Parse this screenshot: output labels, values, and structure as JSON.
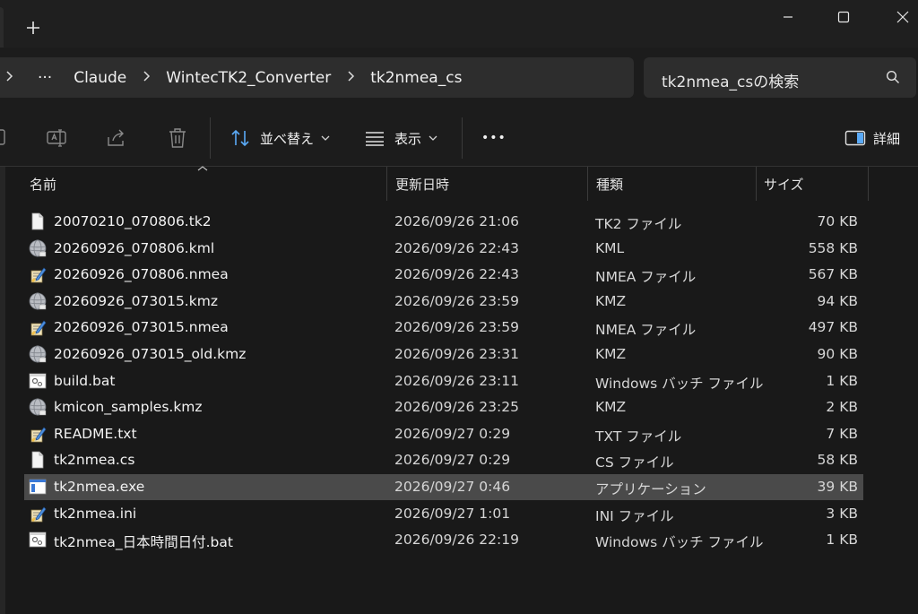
{
  "address": {
    "crumbs": [
      "Claude",
      "WintecTK2_Converter",
      "tk2nmea_cs"
    ],
    "more": "···",
    "search_placeholder": "tk2nmea_csの検索"
  },
  "toolbar": {
    "sort_label": "並べ替え",
    "view_label": "表示",
    "more_label": "•••",
    "details_label": "詳細"
  },
  "columns": {
    "name": "名前",
    "date": "更新日時",
    "type": "種類",
    "size": "サイズ"
  },
  "files": [
    {
      "name": "20070210_070806.tk2",
      "date": "2026/09/26 21:06",
      "type": "TK2 ファイル",
      "size": "70 KB",
      "icon": "file-blank-icon"
    },
    {
      "name": "20260926_070806.kml",
      "date": "2026/09/26 22:43",
      "type": "KML",
      "size": "558 KB",
      "icon": "globe-file-icon"
    },
    {
      "name": "20260926_070806.nmea",
      "date": "2026/09/26 22:43",
      "type": "NMEA ファイル",
      "size": "567 KB",
      "icon": "text-edit-file-icon"
    },
    {
      "name": "20260926_073015.kmz",
      "date": "2026/09/26 23:59",
      "type": "KMZ",
      "size": "94 KB",
      "icon": "globe-file-icon"
    },
    {
      "name": "20260926_073015.nmea",
      "date": "2026/09/26 23:59",
      "type": "NMEA ファイル",
      "size": "497 KB",
      "icon": "text-edit-file-icon"
    },
    {
      "name": "20260926_073015_old.kmz",
      "date": "2026/09/26 23:31",
      "type": "KMZ",
      "size": "90 KB",
      "icon": "globe-file-icon"
    },
    {
      "name": "build.bat",
      "date": "2026/09/26 23:11",
      "type": "Windows バッチ ファイル",
      "size": "1 KB",
      "icon": "batch-file-icon"
    },
    {
      "name": "kmicon_samples.kmz",
      "date": "2026/09/26 23:25",
      "type": "KMZ",
      "size": "2 KB",
      "icon": "globe-file-icon"
    },
    {
      "name": "README.txt",
      "date": "2026/09/27 0:29",
      "type": "TXT ファイル",
      "size": "7 KB",
      "icon": "text-edit-file-icon"
    },
    {
      "name": "tk2nmea.cs",
      "date": "2026/09/27 0:29",
      "type": "CS ファイル",
      "size": "58 KB",
      "icon": "file-blank-icon"
    },
    {
      "name": "tk2nmea.exe",
      "date": "2026/09/27 0:46",
      "type": "アプリケーション",
      "size": "39 KB",
      "icon": "application-icon",
      "selected": true
    },
    {
      "name": "tk2nmea.ini",
      "date": "2026/09/27 1:01",
      "type": "INI ファイル",
      "size": "3 KB",
      "icon": "text-edit-file-icon"
    },
    {
      "name": "tk2nmea_日本時間日付.bat",
      "date": "2026/09/26 22:19",
      "type": "Windows バッチ ファイル",
      "size": "1 KB",
      "icon": "batch-file-icon"
    }
  ],
  "colors": {
    "background": "#191919",
    "selected_row": "#4a4a4a",
    "toolbar": "#1c1c1c",
    "address_bg": "#2d2d2d"
  }
}
